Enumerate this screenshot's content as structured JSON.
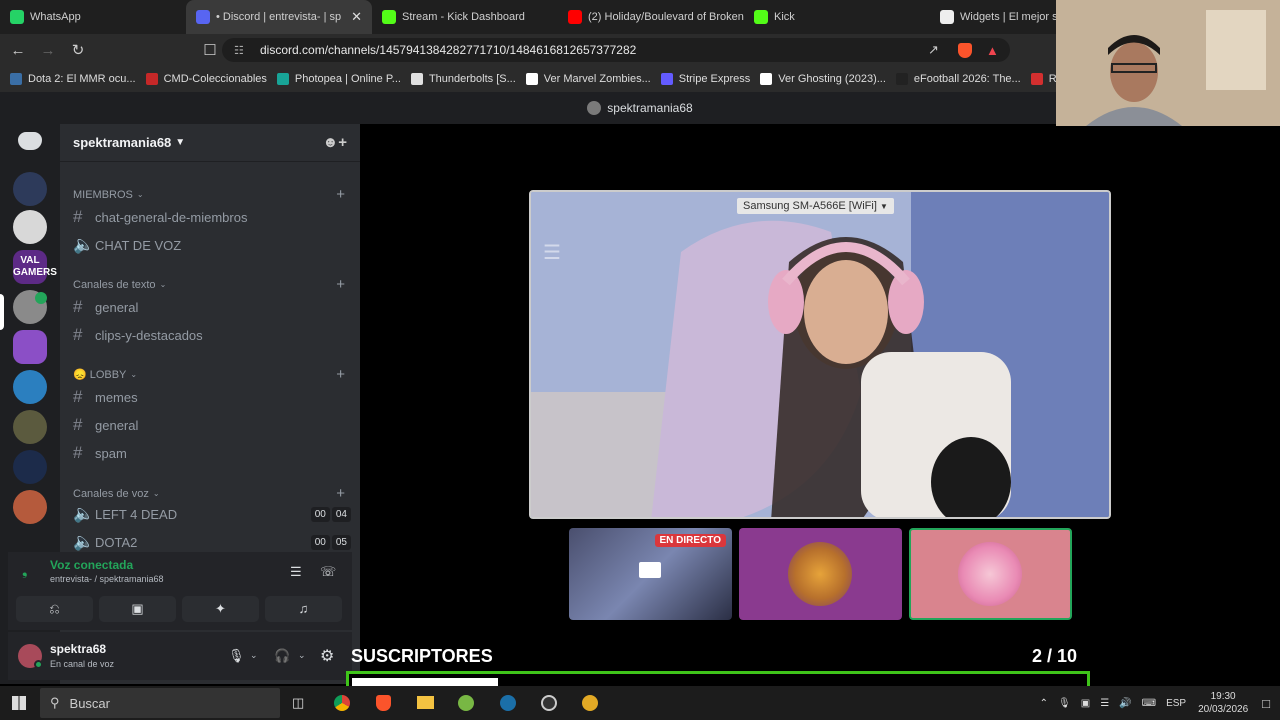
{
  "browser": {
    "tabs": [
      {
        "label": "WhatsApp",
        "icon": "whatsapp-icon",
        "color": "#25d366"
      },
      {
        "label": "• Discord | entrevista- | sp",
        "icon": "discord-icon",
        "color": "#5865f2"
      },
      {
        "label": "Stream - Kick Dashboard",
        "icon": "kick-icon",
        "color": "#53fc18"
      },
      {
        "label": "(2) Holiday/Boulevard of Broken",
        "icon": "youtube-icon",
        "color": "#ff0000"
      },
      {
        "label": "Kick",
        "icon": "kick-icon",
        "color": "#53fc18"
      },
      {
        "label": "Widgets | El mejor softw",
        "icon": "widgets-icon",
        "color": "#eeeeee"
      }
    ],
    "url": "discord.com/channels/1457941384282771710/1484616812657377282",
    "bookmarks": [
      {
        "label": "Dota 2: El MMR ocu...",
        "color": "#3a6ea5"
      },
      {
        "label": "CMD-Coleccionables",
        "color": "#c62828"
      },
      {
        "label": "Photopea | Online P...",
        "color": "#18a497"
      },
      {
        "label": "Thunderbolts [S...",
        "color": "#e0e0e0"
      },
      {
        "label": "Ver Marvel Zombies...",
        "color": "#ffffff"
      },
      {
        "label": "Stripe Express",
        "color": "#635bff"
      },
      {
        "label": "Ver Ghosting (2023)...",
        "color": "#ffffff"
      },
      {
        "label": "eFootball 2026: The...",
        "color": "#222222"
      },
      {
        "label": "Rust | Kic",
        "color": "#d32f2f"
      }
    ]
  },
  "discord": {
    "window_title": "spektramania68",
    "guild_name": "spektramania68",
    "categories": {
      "miembros": "MIEMBROS",
      "texto": "Canales de texto",
      "lobby": "LOBBY",
      "voz": "Canales de voz"
    },
    "channels": {
      "chat_general": "chat-general-de-miembros",
      "chat_voz": "CHAT DE VOZ",
      "general1": "general",
      "clips": "clips-y-destacados",
      "memes": "memes",
      "general2": "general",
      "spam": "spam",
      "l4d": "LEFT 4 DEAD",
      "dota": "DOTA2"
    },
    "voice_counts": {
      "l4d_a": "00",
      "l4d_b": "04",
      "dota_a": "00",
      "dota_b": "05"
    },
    "lobby_emoji": "😞",
    "voice_status": "Voz conectada",
    "voice_location": "entrevista- / spektramania68",
    "user_name": "spektra68",
    "user_status": "En canal de voz"
  },
  "stream": {
    "device_label": "Samsung SM-A566E [WiFi]",
    "live_badge": "EN DIRECTO"
  },
  "overlay": {
    "title": "SUSCRIPTORES",
    "count": "2  / 10",
    "progress": 0.2,
    "bar_color": "#3fc41a"
  },
  "taskbar": {
    "search_placeholder": "Buscar",
    "lang": "ESP",
    "time": "19:30",
    "date": "20/03/2026"
  }
}
